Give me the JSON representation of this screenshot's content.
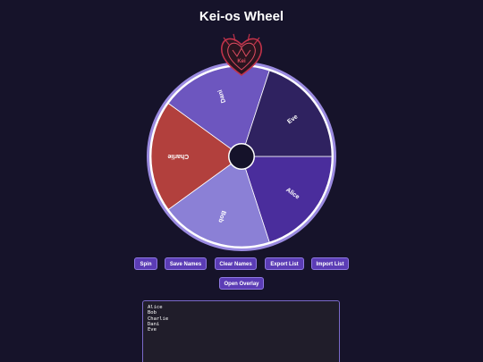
{
  "app": {
    "title": "Kei-os Wheel"
  },
  "wheel": {
    "segments": [
      {
        "label": "Alice",
        "color": "#4a2d9c"
      },
      {
        "label": "Bob",
        "color": "#8b80d6"
      },
      {
        "label": "Charlie",
        "color": "#b2403d"
      },
      {
        "label": "Dani",
        "color": "#6d56bf"
      },
      {
        "label": "Eve",
        "color": "#2f2260"
      }
    ],
    "rim_color": "#9a8ae0",
    "hub_color": "#15122a",
    "pointer_icon": "heart-crest-icon"
  },
  "toolbar": {
    "spin_label": "Spin",
    "save_label": "Save Names",
    "clear_label": "Clear Names",
    "export_label": "Export List",
    "import_label": "Import List",
    "overlay_label": "Open Overlay"
  },
  "names_list": {
    "value": "Alice\nBob\nCharlie\nDani\nEve"
  }
}
